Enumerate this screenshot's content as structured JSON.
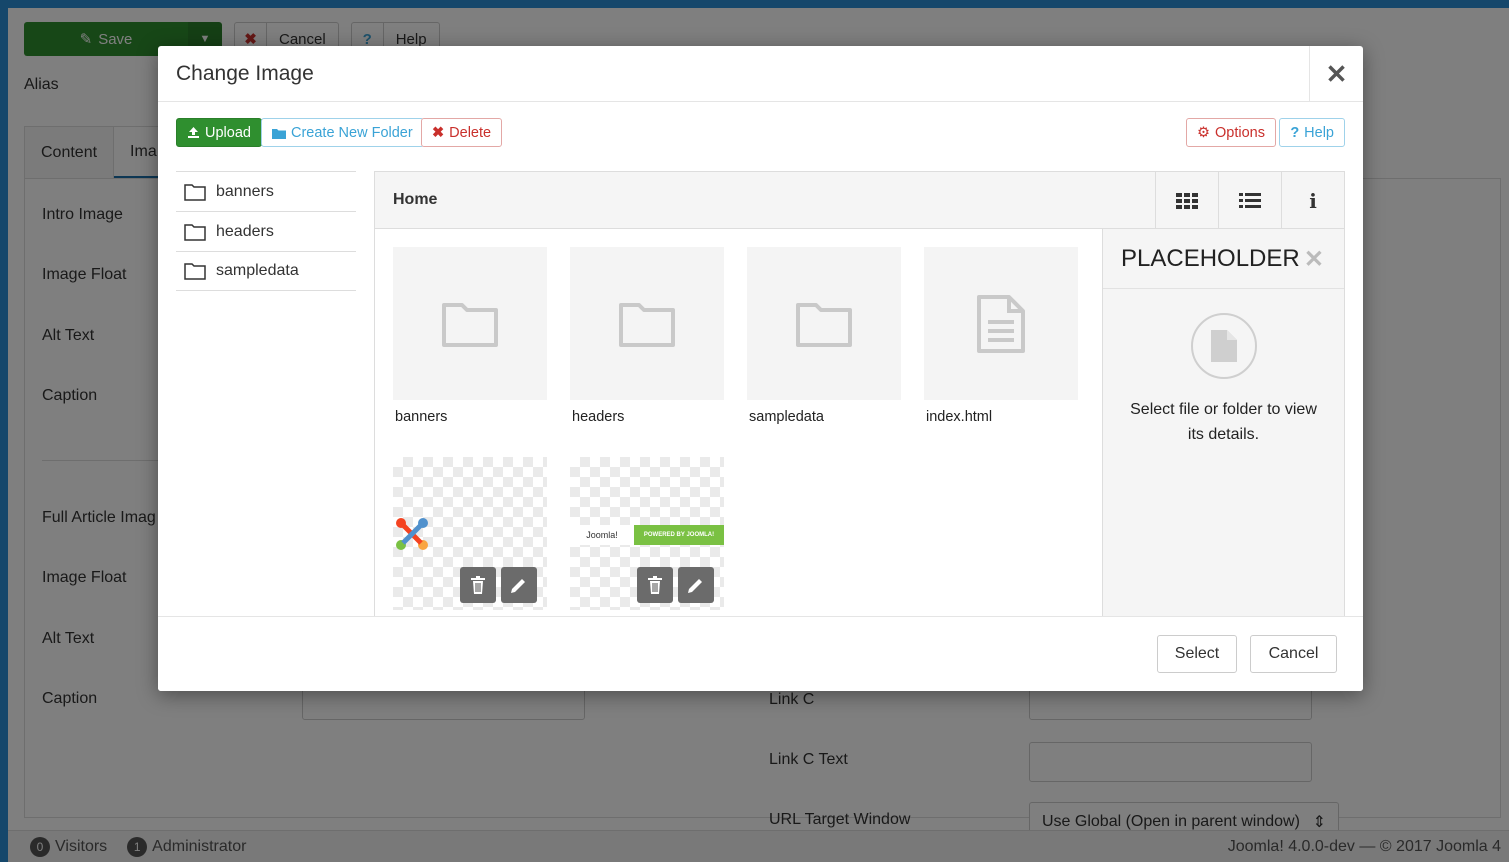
{
  "toolbar": {
    "save_label": "Save",
    "cancel_label": "Cancel",
    "help_label": "Help"
  },
  "alias_label": "Alias",
  "tabs": [
    {
      "label": "Content"
    },
    {
      "label": "Ima"
    }
  ],
  "left_labels": [
    "Intro Image",
    "Image Float",
    "Alt Text",
    "Caption",
    "Full Article Imag",
    "Image Float",
    "Alt Text",
    "Caption"
  ],
  "right_labels": {
    "link_c": "Link C",
    "link_c_text": "Link C Text",
    "url_target": "URL Target Window"
  },
  "url_target_value": "Use Global (Open in parent window)",
  "statusbar": {
    "visitors_count": "0",
    "visitors_label": "Visitors",
    "admin_count": "1",
    "admin_label": "Administrator",
    "version": "Joomla! 4.0.0-dev — © 2017 Joomla 4"
  },
  "modal": {
    "title": "Change Image",
    "close_glyph": "✕",
    "toolbar": {
      "upload": "Upload",
      "create_folder": "Create New Folder",
      "delete": "Delete",
      "options": "Options",
      "help": "Help"
    },
    "tree": [
      {
        "label": "banners"
      },
      {
        "label": "headers"
      },
      {
        "label": "sampledata"
      }
    ],
    "breadcrumb": "Home",
    "items": [
      {
        "name": "banners",
        "kind": "folder"
      },
      {
        "name": "headers",
        "kind": "folder"
      },
      {
        "name": "sampledata",
        "kind": "folder"
      },
      {
        "name": "index.html",
        "kind": "file"
      },
      {
        "name": "",
        "kind": "image-joomla-logo"
      },
      {
        "name": "",
        "kind": "image-powered-by"
      }
    ],
    "powered_by": {
      "logo_text": "Joomla!",
      "badge_text": "POWERED BY JOOMLA!"
    },
    "info": {
      "title": "PLACEHOLDER",
      "text": "Select file or folder to view its details."
    },
    "footer": {
      "select": "Select",
      "cancel": "Cancel"
    }
  },
  "colors": {
    "accent": "#2a8fd6",
    "success": "#2f8f2f",
    "danger": "#c9302c",
    "info": "#3aa3d6"
  }
}
